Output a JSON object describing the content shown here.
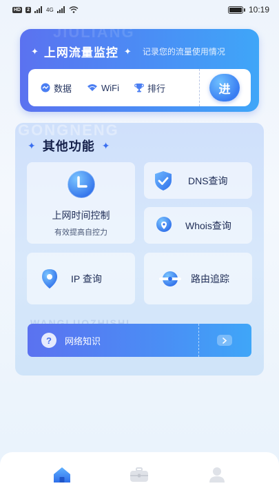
{
  "status_bar": {
    "hd_badge": "HD",
    "sim_badge": "2",
    "signal_label": "4G",
    "time": "10:19"
  },
  "monitor": {
    "watermark": "JIULIANG",
    "title": "上网流量监控",
    "subtitle": "记录您的流量使用情况",
    "items": [
      {
        "label": "数据",
        "icon": "data-icon"
      },
      {
        "label": "WiFi",
        "icon": "wifi-icon"
      },
      {
        "label": "排行",
        "icon": "trophy-icon"
      }
    ],
    "go_label": "进"
  },
  "functions": {
    "watermark": "GONGNENG",
    "title": "其他功能",
    "time_control": {
      "label": "上网时间控制",
      "sub": "有效提高自控力",
      "icon": "clock-icon"
    },
    "dns": {
      "label": "DNS查询",
      "icon": "shield-check-icon"
    },
    "whois": {
      "label": "Whois查询",
      "icon": "location-pin-icon"
    },
    "ip": {
      "label": "IP 查询",
      "icon": "location-pin-icon"
    },
    "route": {
      "label": "路由追踪",
      "icon": "router-icon"
    },
    "knowledge": {
      "watermark": "WANGLUOZHISHI",
      "label": "网络知识",
      "icon": "question-icon"
    }
  },
  "bottom_nav": {
    "items": [
      {
        "icon": "home-icon",
        "active": true
      },
      {
        "icon": "toolbox-icon",
        "active": false
      },
      {
        "icon": "user-icon",
        "active": false
      }
    ]
  },
  "colors": {
    "accent": "#4a7ef2",
    "accent_light": "#3fa6f8",
    "panel_bg": "#d3e3fb",
    "text_dark": "#14204a"
  }
}
